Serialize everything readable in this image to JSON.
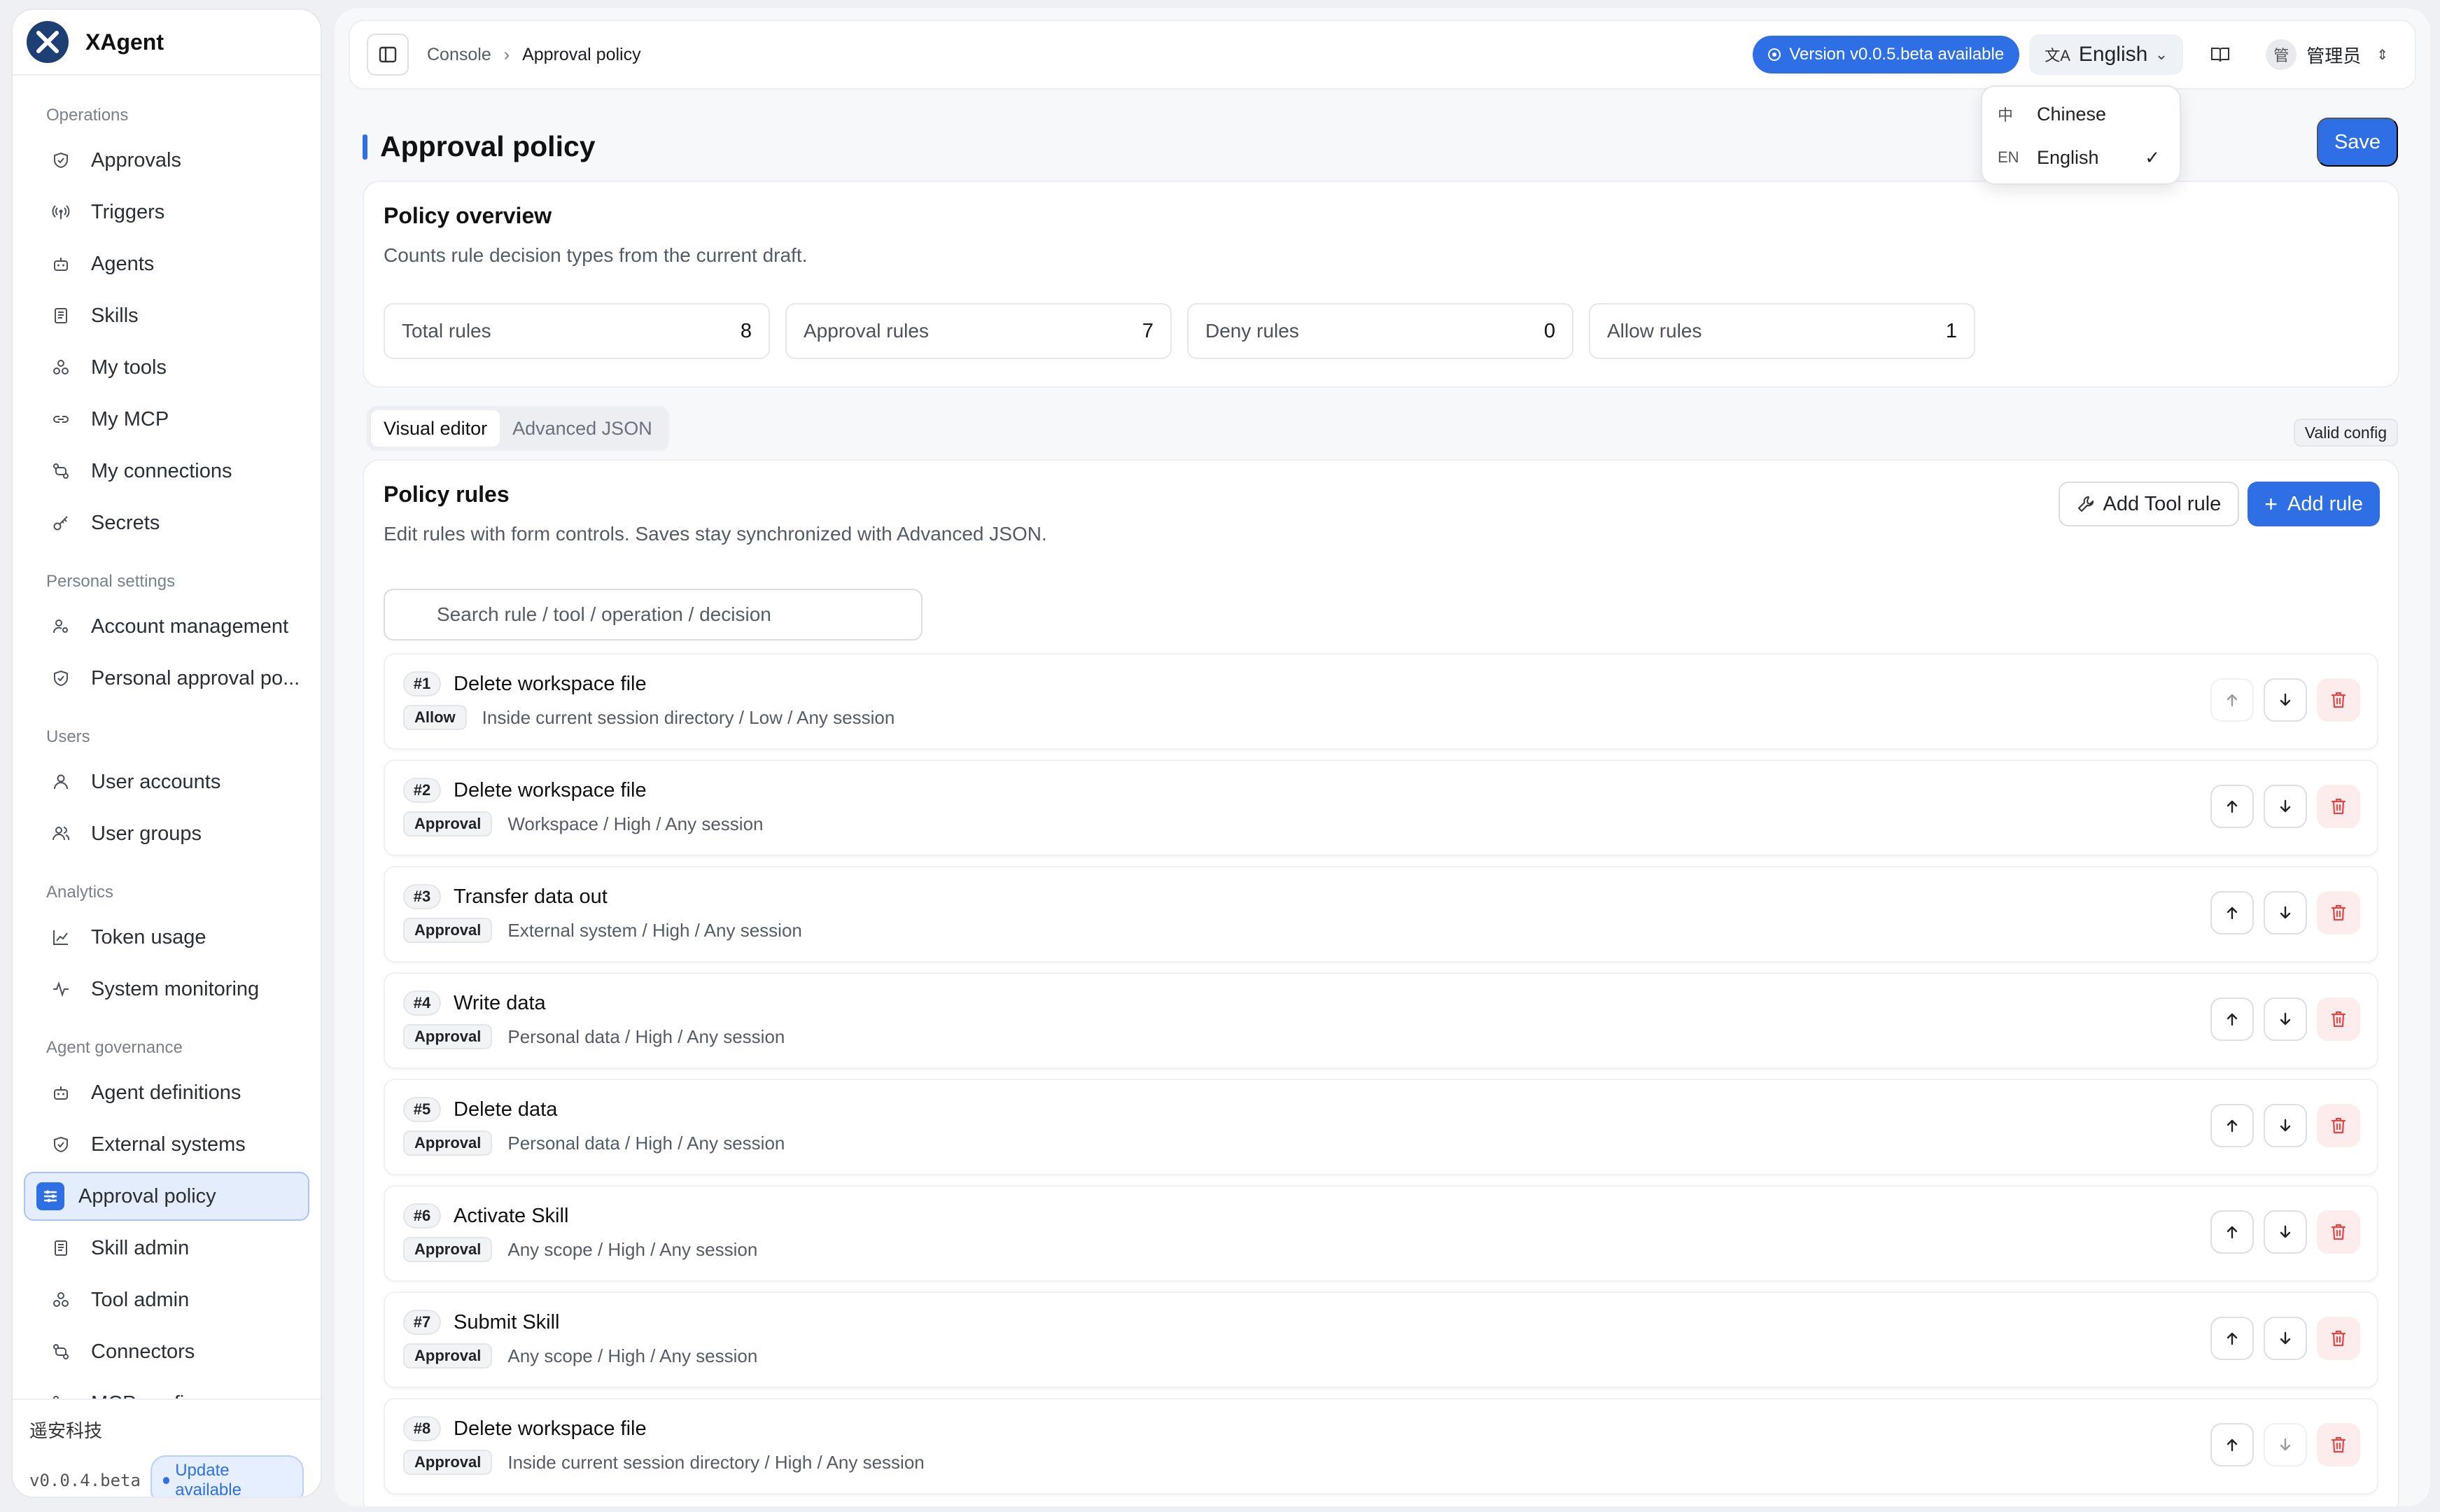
{
  "app": {
    "name": "XAgent"
  },
  "sidebar": {
    "sections": [
      {
        "title": "Operations",
        "items": [
          {
            "label": "Approvals",
            "icon": "shield-check-icon"
          },
          {
            "label": "Triggers",
            "icon": "broadcast-icon"
          },
          {
            "label": "Agents",
            "icon": "bot-icon"
          },
          {
            "label": "Skills",
            "icon": "book-icon"
          },
          {
            "label": "My tools",
            "icon": "tools-icon"
          },
          {
            "label": "My MCP",
            "icon": "link-icon"
          },
          {
            "label": "My connections",
            "icon": "connection-icon"
          },
          {
            "label": "Secrets",
            "icon": "key-icon"
          }
        ]
      },
      {
        "title": "Personal settings",
        "items": [
          {
            "label": "Account management",
            "icon": "user-gear-icon"
          },
          {
            "label": "Personal approval po...",
            "icon": "shield-check-icon"
          }
        ]
      },
      {
        "title": "Users",
        "items": [
          {
            "label": "User accounts",
            "icon": "user-icon"
          },
          {
            "label": "User groups",
            "icon": "users-icon"
          }
        ]
      },
      {
        "title": "Analytics",
        "items": [
          {
            "label": "Token usage",
            "icon": "chart-line-icon"
          },
          {
            "label": "System monitoring",
            "icon": "activity-icon"
          }
        ]
      },
      {
        "title": "Agent governance",
        "items": [
          {
            "label": "Agent definitions",
            "icon": "bot-icon"
          },
          {
            "label": "External systems",
            "icon": "shield-check-icon"
          },
          {
            "label": "Approval policy",
            "icon": "sliders-icon",
            "active": true
          },
          {
            "label": "Skill admin",
            "icon": "book-icon"
          },
          {
            "label": "Tool admin",
            "icon": "tools-icon"
          },
          {
            "label": "Connectors",
            "icon": "connection-icon"
          },
          {
            "label": "MCP config",
            "icon": "connection-icon"
          }
        ]
      }
    ],
    "footer": {
      "company": "遥安科技",
      "version": "v0.0.4.beta",
      "update_label": "Update available"
    }
  },
  "topbar": {
    "breadcrumb": [
      "Console",
      "Approval policy"
    ],
    "version_label": "Version v0.0.5.beta available",
    "language": "English",
    "user": {
      "avatar_char": "管",
      "name": "管理员"
    }
  },
  "language_menu": [
    {
      "code": "中",
      "label": "Chinese",
      "selected": false
    },
    {
      "code": "EN",
      "label": "English",
      "selected": true
    }
  ],
  "page": {
    "title": "Approval policy",
    "save_label": "Save"
  },
  "overview": {
    "title": "Policy overview",
    "subtitle": "Counts rule decision types from the current draft.",
    "stats": [
      {
        "label": "Total rules",
        "value": "8"
      },
      {
        "label": "Approval rules",
        "value": "7"
      },
      {
        "label": "Deny rules",
        "value": "0"
      },
      {
        "label": "Allow rules",
        "value": "1"
      }
    ]
  },
  "tabs": [
    {
      "label": "Visual editor",
      "active": true
    },
    {
      "label": "Advanced JSON",
      "active": false
    }
  ],
  "valid_label": "Valid config",
  "rules": {
    "title": "Policy rules",
    "subtitle": "Edit rules with form controls. Saves stay synchronized with Advanced JSON.",
    "add_tool_label": "Add Tool rule",
    "add_rule_label": "Add rule",
    "search_placeholder": "Search rule / tool / operation / decision",
    "items": [
      {
        "num": "#1",
        "name": "Delete workspace file",
        "decision": "Allow",
        "desc": "Inside current session directory / Low / Any session"
      },
      {
        "num": "#2",
        "name": "Delete workspace file",
        "decision": "Approval",
        "desc": "Workspace / High / Any session"
      },
      {
        "num": "#3",
        "name": "Transfer data out",
        "decision": "Approval",
        "desc": "External system / High / Any session"
      },
      {
        "num": "#4",
        "name": "Write data",
        "decision": "Approval",
        "desc": "Personal data / High / Any session"
      },
      {
        "num": "#5",
        "name": "Delete data",
        "decision": "Approval",
        "desc": "Personal data / High / Any session"
      },
      {
        "num": "#6",
        "name": "Activate Skill",
        "decision": "Approval",
        "desc": "Any scope / High / Any session"
      },
      {
        "num": "#7",
        "name": "Submit Skill",
        "decision": "Approval",
        "desc": "Any scope / High / Any session"
      },
      {
        "num": "#8",
        "name": "Delete workspace file",
        "decision": "Approval",
        "desc": "Inside current session directory / High / Any session"
      }
    ]
  },
  "colors": {
    "accent": "#2f6fe6",
    "danger": "#e04848"
  }
}
